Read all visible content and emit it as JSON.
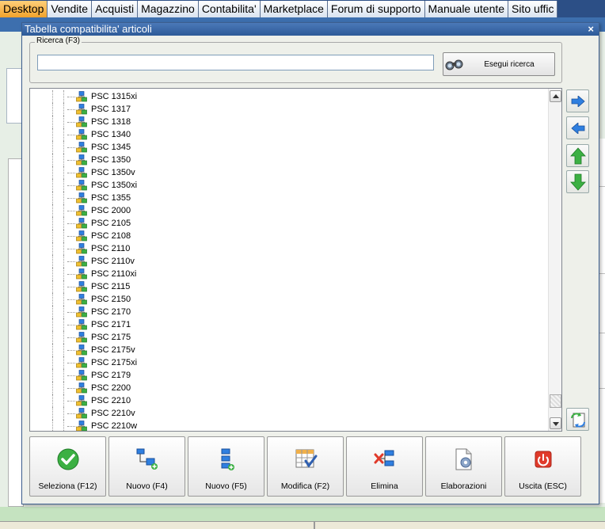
{
  "menu": {
    "tabs": [
      "Desktop",
      "Vendite",
      "Acquisti",
      "Magazzino",
      "Contabilita'",
      "Marketplace",
      "Forum di supporto",
      "Manuale utente",
      "Sito uffic"
    ],
    "active": 0
  },
  "dialog": {
    "title": "Tabella compatibilita' articoli",
    "close": "×"
  },
  "search": {
    "legend": "Ricerca (F3)",
    "value": "",
    "button_label": "Esegui ricerca"
  },
  "tree": {
    "items": [
      "PSC 1315xi",
      "PSC 1317",
      "PSC 1318",
      "PSC 1340",
      "PSC 1345",
      "PSC 1350",
      "PSC 1350v",
      "PSC 1350xi",
      "PSC 1355",
      "PSC 2000",
      "PSC 2105",
      "PSC 2108",
      "PSC 2110",
      "PSC 2110v",
      "PSC 2110xi",
      "PSC 2115",
      "PSC 2150",
      "PSC 2170",
      "PSC 2171",
      "PSC 2175",
      "PSC 2175v",
      "PSC 2175xi",
      "PSC 2179",
      "PSC 2200",
      "PSC 2210",
      "PSC 2210v",
      "PSC 2210w"
    ]
  },
  "toolbar": {
    "seleziona": "Seleziona (F12)",
    "nuovo_f4": "Nuovo (F4)",
    "nuovo_f5": "Nuovo (F5)",
    "modifica": "Modifica (F2)",
    "elimina": "Elimina",
    "elaborazioni": "Elaborazioni",
    "uscita": "Uscita (ESC)"
  },
  "colors": {
    "active_tab": "#f0a22c",
    "title_bar": "#2d5a98",
    "accent_green": "#3cb043",
    "accent_red": "#e03a2a"
  }
}
